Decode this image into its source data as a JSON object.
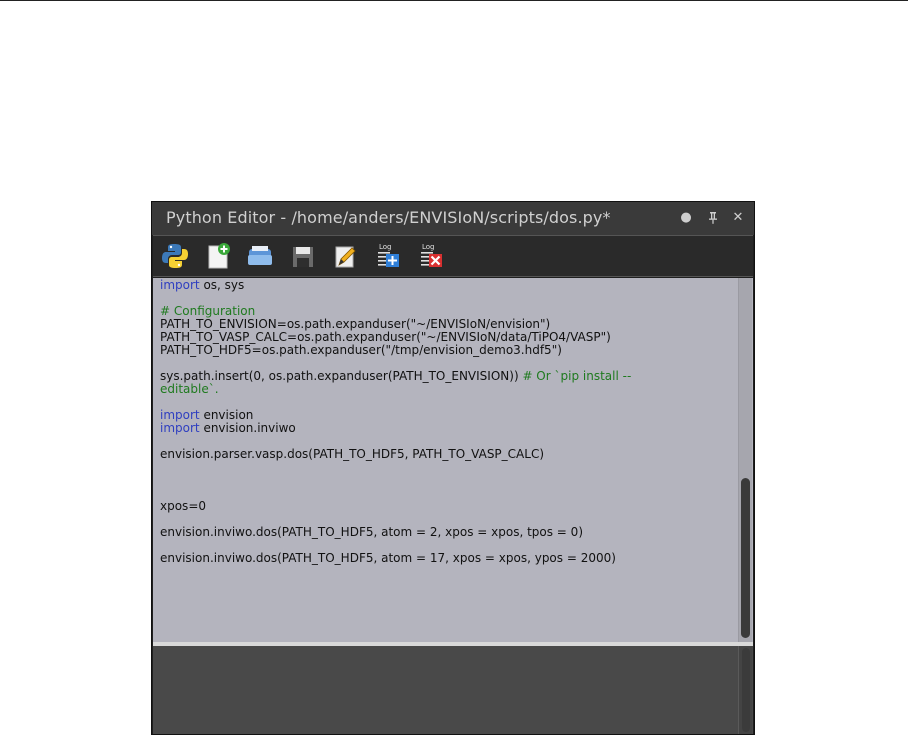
{
  "window": {
    "title": "Python Editor - /home/anders/ENVISIoN/scripts/dos.py*",
    "float_button": "●",
    "pin_button": "⇞",
    "close_button": "✕"
  },
  "toolbar": {
    "buttons": [
      {
        "name": "run-python",
        "icon": "python-logo-icon"
      },
      {
        "name": "new-script",
        "icon": "new-file-icon"
      },
      {
        "name": "open-script",
        "icon": "open-folder-icon"
      },
      {
        "name": "save-script",
        "icon": "save-icon"
      },
      {
        "name": "save-as",
        "icon": "edit-pencil-icon"
      },
      {
        "name": "log-append",
        "icon": "log-add-icon",
        "label": "Log"
      },
      {
        "name": "log-clear",
        "icon": "log-clear-icon",
        "label": "Log"
      }
    ]
  },
  "code": {
    "lines": [
      [
        {
          "t": "import",
          "c": "kw"
        },
        {
          "t": " os, sys"
        }
      ],
      [],
      [
        {
          "t": "# Configuration",
          "c": "cm"
        }
      ],
      [
        {
          "t": "PATH_TO_ENVISION=os.path.expanduser(\"~/ENVISIoN/envision\")"
        }
      ],
      [
        {
          "t": "PATH_TO_VASP_CALC=os.path.expanduser(\"~/ENVISIoN/data/TiPO4/VASP\")"
        }
      ],
      [
        {
          "t": "PATH_TO_HDF5=os.path.expanduser(\"/tmp/envision_demo3.hdf5\")"
        }
      ],
      [],
      [
        {
          "t": "sys.path.insert(0, os.path.expanduser(PATH_TO_ENVISION)) "
        },
        {
          "t": "# Or `pip install --",
          "c": "cm"
        }
      ],
      [
        {
          "t": "editable`.",
          "c": "cm"
        }
      ],
      [],
      [
        {
          "t": "import",
          "c": "kw"
        },
        {
          "t": " envision"
        }
      ],
      [
        {
          "t": "import",
          "c": "kw"
        },
        {
          "t": " envision.inviwo"
        }
      ],
      [],
      [
        {
          "t": "envision.parser.vasp.dos(PATH_TO_HDF5, PATH_TO_VASP_CALC)"
        }
      ],
      [],
      [],
      [],
      [
        {
          "t": "xpos=0"
        }
      ],
      [],
      [
        {
          "t": "envision.inviwo.dos(PATH_TO_HDF5, atom = 2, xpos = xpos, tpos = 0)"
        }
      ],
      [],
      [
        {
          "t": "envision.inviwo.dos(PATH_TO_HDF5, atom = 17, xpos = xpos, ypos = 2000)"
        }
      ]
    ]
  },
  "colors": {
    "editor_bg": "#b4b4be",
    "keyword": "#2f3fc0",
    "comment": "#1f7a1f",
    "output_bg": "#494949",
    "titlebar_bg": "#3a3a3a"
  }
}
